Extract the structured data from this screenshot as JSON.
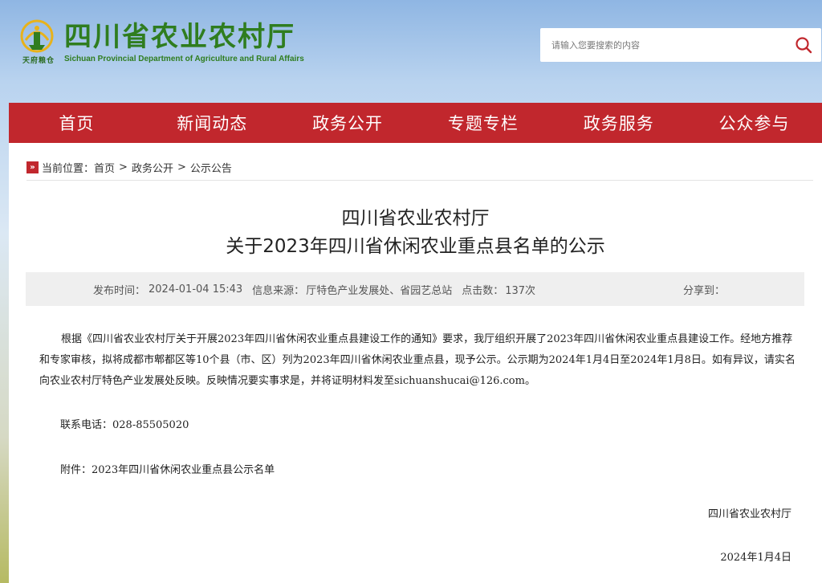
{
  "header": {
    "logo_title": "四川省农业农村厅",
    "logo_en": "Sichuan Provincial Department of Agriculture and Rural Affairs",
    "logo_mark_text": "天府粮仓",
    "brand_color": "#2f7d1f"
  },
  "search": {
    "placeholder": "请输入您要搜索的内容",
    "icon": "search-icon"
  },
  "nav": {
    "color": "#c1272d",
    "items": [
      {
        "label": "首页"
      },
      {
        "label": "新闻动态"
      },
      {
        "label": "政务公开"
      },
      {
        "label": "专题专栏"
      },
      {
        "label": "政务服务"
      },
      {
        "label": "公众参与"
      }
    ]
  },
  "breadcrumb": {
    "prefix": "当前位置：",
    "items": [
      "首页",
      "政务公开",
      "公示公告"
    ],
    "separator": ">"
  },
  "article": {
    "title_line1": "四川省农业农村厅",
    "title_line2": "关于2023年四川省休闲农业重点县名单的公示",
    "meta": {
      "publish_label": "发布时间：",
      "publish_time": "2024-01-04 15:43",
      "source_label": "信息来源：",
      "source": "厅特色产业发展处、省园艺总站",
      "clicks_label": "点击数：",
      "clicks": "137次",
      "share_label": "分享到："
    },
    "body": "根据《四川省农业农村厅关于开展2023年四川省休闲农业重点县建设工作的通知》要求，我厅组织开展了2023年四川省休闲农业重点县建设工作。经地方推荐和专家审核，拟将成都市郫都区等10个县（市、区）列为2023年四川省休闲农业重点县，现予公示。公示期为2024年1月4日至2024年1月8日。如有异议，请实名向农业农村厅特色产业发展处反映。反映情况要实事求是，并将证明材料发至sichuanshucai@126.com。",
    "contact": "联系电话：028-85505020",
    "attachment_label": "附件：",
    "attachment": "2023年四川省休闲农业重点县公示名单",
    "signature": "四川省农业农村厅",
    "date": "2024年1月4日"
  }
}
